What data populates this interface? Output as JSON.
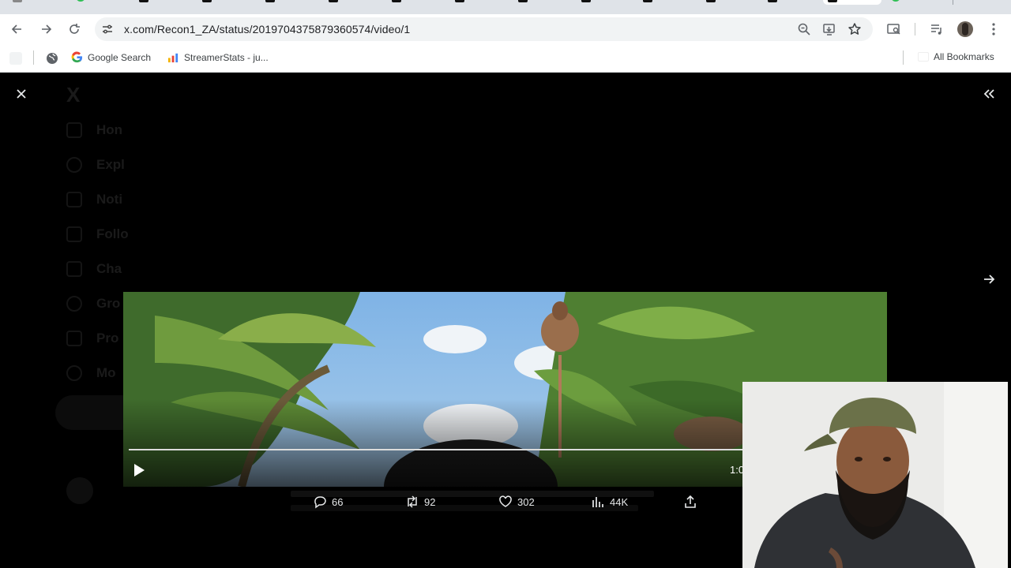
{
  "browser": {
    "url": "x.com/Recon1_ZA/status/2019704375879360574/video/1",
    "bookmarks": [
      {
        "label": "Google Search",
        "icon": "google-icon"
      },
      {
        "label": "StreamerStats - ju...",
        "icon": "bar-chart-icon"
      }
    ],
    "all_bookmarks_label": "All Bookmarks"
  },
  "background_nav": [
    "Hon",
    "Expl",
    "Noti",
    "Follo",
    "Cha",
    "Gro",
    "Pro",
    "Mo"
  ],
  "media_viewer": {
    "timecode": "1:0",
    "stats": {
      "replies": "66",
      "reposts": "92",
      "likes": "302",
      "views": "44K"
    }
  },
  "colors": {
    "accent": "#1d9bf0",
    "overlay_bg": "#000000",
    "icon_light": "#e7e9ea"
  }
}
